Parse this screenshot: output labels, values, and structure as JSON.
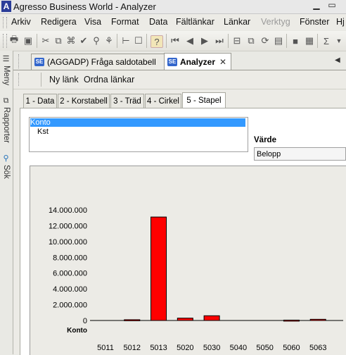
{
  "window": {
    "title": "Agresso Business World - Analyzer",
    "app_icon_letter": "A"
  },
  "menu": [
    {
      "label": "Arkiv",
      "disabled": false
    },
    {
      "label": "Redigera",
      "disabled": false
    },
    {
      "label": "Visa",
      "disabled": false
    },
    {
      "label": "Format",
      "disabled": false
    },
    {
      "label": "Data",
      "disabled": false
    },
    {
      "label": "Fältlänkar",
      "disabled": false
    },
    {
      "label": "Länkar",
      "disabled": false
    },
    {
      "label": "Verktyg",
      "disabled": true
    },
    {
      "label": "Fönster",
      "disabled": false
    },
    {
      "label": "Hj",
      "disabled": false
    }
  ],
  "sidebar": {
    "items": [
      "Meny",
      "Rapporter",
      "Sök"
    ]
  },
  "doc_tabs": [
    {
      "badge": "SE",
      "label": "(AGGADP) Fråga saldotabell",
      "active": false
    },
    {
      "badge": "SE",
      "label": "Analyzer",
      "active": true,
      "close": "✕"
    }
  ],
  "link_bar": {
    "new_link": "Ny länk",
    "order_links": "Ordna länkar"
  },
  "view_tabs": [
    "1 - Data",
    "2 - Korstabell",
    "3 - Träd",
    "4 - Cirkel",
    "5 - Stapel"
  ],
  "active_view_tab": "5 - Stapel",
  "dimension_list": {
    "items": [
      "Konto",
      "Kst"
    ],
    "selected": "Konto"
  },
  "value_field": {
    "label": "Värde",
    "selected": "Belopp"
  },
  "chart_data": {
    "type": "bar",
    "categories": [
      "5011",
      "5012",
      "5013",
      "5020",
      "5030",
      "5040",
      "5050",
      "5060",
      "5063"
    ],
    "values": [
      0,
      100000,
      13100000,
      300000,
      600000,
      0,
      0,
      50000,
      150000
    ],
    "xlabel": "Konto",
    "ylim": [
      0,
      14000000
    ],
    "y_ticks": [
      "14.000.000",
      "12.000.000",
      "10.000.000",
      "8.000.000",
      "6.000.000",
      "4.000.000",
      "2.000.000",
      "0"
    ],
    "bar_color": "#ff0000",
    "grid": false
  }
}
